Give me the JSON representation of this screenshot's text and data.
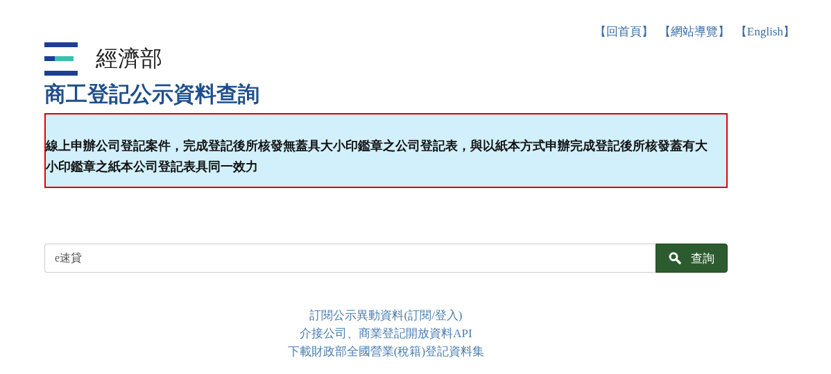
{
  "top_links": [
    "【回首頁】",
    "【網站導覽】",
    "【English】"
  ],
  "logo": {
    "text": "經濟部"
  },
  "title": "商工登記公示資料查詢",
  "notice": "線上申辦公司登記案件，完成登記後所核發無蓋具大小印鑑章之公司登記表，與以紙本方式申辦完成登記後所核發蓋有大小印鑑章之紙本公司登記表具同一效力",
  "search": {
    "value": "e速貸",
    "button": "查詢"
  },
  "footer_links": [
    "訂閱公示異動資料(訂閱/登入)",
    "介接公司、商業登記開放資料API",
    "下載財政部全國營業(稅籍)登記資料集"
  ]
}
